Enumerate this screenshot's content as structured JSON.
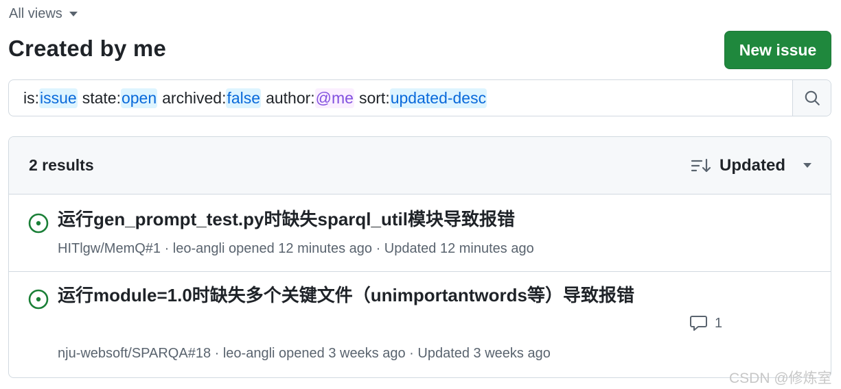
{
  "view_switcher": {
    "label": "All views"
  },
  "page_title": "Created by me",
  "new_issue_button": {
    "label": "New issue"
  },
  "search": {
    "tokens": [
      {
        "key": "is:",
        "value": "issue"
      },
      {
        "key": "state:",
        "value": "open"
      },
      {
        "key": "archived:",
        "value": "false"
      },
      {
        "key": "author:",
        "value": "@me"
      },
      {
        "key": "sort:",
        "value": "updated-desc"
      }
    ]
  },
  "results": {
    "count_label": "2 results",
    "sort_label": "Updated",
    "issues": [
      {
        "title": "运行gen_prompt_test.py时缺失sparql_util模块导致报错",
        "repo_ref": "HITlgw/MemQ#1",
        "meta": "· leo-angli opened 12 minutes ago · Updated 12 minutes ago",
        "comments": ""
      },
      {
        "title": "运行module=1.0时缺失多个关键文件（unimportantwords等）导致报错",
        "repo_ref": "nju-websoft/SPARQA#18",
        "meta": "· leo-angli opened 3 weeks ago · Updated 3 weeks ago",
        "comments": "1"
      }
    ]
  },
  "watermark": "CSDN @修炼室",
  "colors": {
    "open_issue_green": "#1a7f37",
    "button_green": "#1f883d",
    "token_blue": "#0969da",
    "token_purple": "#8250df"
  },
  "icons": [
    "triangle-down-icon",
    "search-icon",
    "sort-desc-icon",
    "issue-opened-icon",
    "comment-icon"
  ]
}
